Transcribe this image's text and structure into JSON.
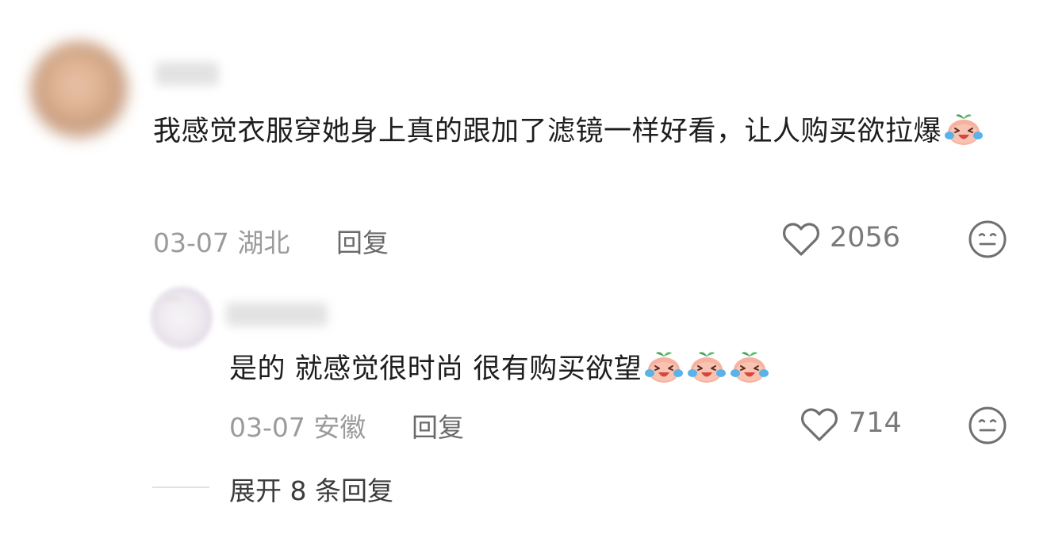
{
  "comments": [
    {
      "text": "我感觉衣服穿她身上真的跟加了滤镜一样好看，让人购买欲拉爆",
      "emoji_count": 1,
      "date_location": "03-07 湖北",
      "reply_label": "回复",
      "likes": "2056"
    },
    {
      "text": "是的 就感觉很时尚 很有购买欲望",
      "emoji_count": 3,
      "date_location": "03-07 安徽",
      "reply_label": "回复",
      "likes": "714"
    }
  ],
  "expand_replies": "展开 8 条回复",
  "icons": {
    "like": "heart-outline-icon",
    "react": "neutral-face-icon",
    "emoji": "crying-laughing-peach-emoji"
  },
  "colors": {
    "text": "#1e1e1e",
    "meta": "#9b9b9b",
    "reply": "#6a6a6a",
    "icon": "#707070"
  }
}
